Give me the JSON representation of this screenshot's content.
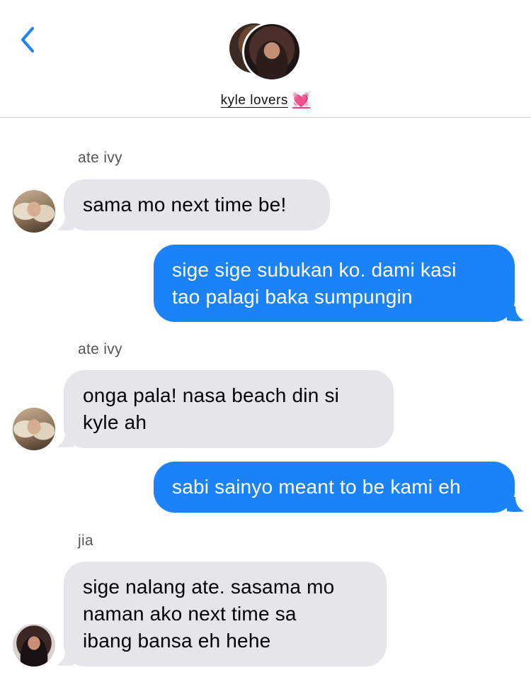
{
  "header": {
    "group_name": "kyle lovers",
    "heart_emoji": "💓",
    "back_icon": "chevron-left-icon",
    "accent_color": "#1b83f7"
  },
  "messages": [
    {
      "sender": "ate ivy",
      "direction": "incoming",
      "text_lines": [
        "sama mo next time be!"
      ]
    },
    {
      "direction": "outgoing",
      "text_lines": [
        "sige sige subukan ko. dami kasi",
        "tao palagi baka sumpungin"
      ]
    },
    {
      "sender": "ate ivy",
      "direction": "incoming",
      "text_lines": [
        "onga pala! nasa beach din si",
        "kyle ah"
      ]
    },
    {
      "direction": "outgoing",
      "text_lines": [
        "sabi sainyo meant to be kami eh"
      ]
    },
    {
      "sender": "jia",
      "direction": "incoming",
      "text_lines": [
        "sige nalang ate. sasama mo",
        "naman ako next time sa",
        "ibang bansa eh hehe"
      ]
    }
  ],
  "colors": {
    "incoming_bubble": "#e5e5ea",
    "outgoing_bubble": "#1b83f7"
  }
}
